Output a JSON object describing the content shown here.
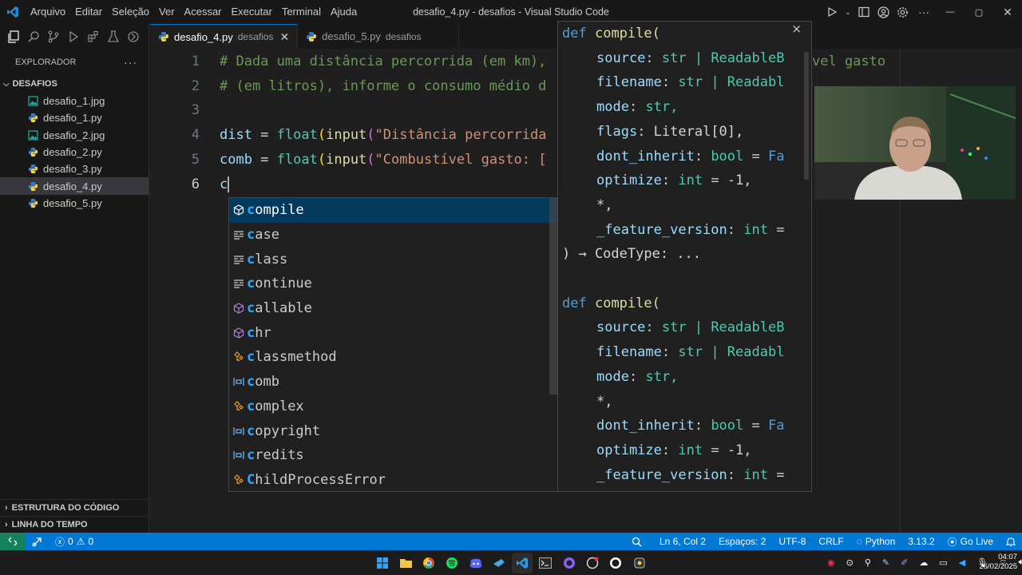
{
  "titlebar": {
    "menu": [
      "Arquivo",
      "Editar",
      "Seleção",
      "Ver",
      "Acessar",
      "Executar",
      "Terminal",
      "Ajuda"
    ],
    "title": "desafio_4.py - desafios - Visual Studio Code"
  },
  "sidebar": {
    "explorer_title": "EXPLORADOR",
    "more": "···",
    "folder": "DESAFIOS",
    "files": [
      {
        "name": "desafio_1.jpg",
        "kind": "image"
      },
      {
        "name": "desafio_1.py",
        "kind": "python"
      },
      {
        "name": "desafio_2.jpg",
        "kind": "image"
      },
      {
        "name": "desafio_2.py",
        "kind": "python"
      },
      {
        "name": "desafio_3.py",
        "kind": "python"
      },
      {
        "name": "desafio_4.py",
        "kind": "python",
        "active": true
      },
      {
        "name": "desafio_5.py",
        "kind": "python"
      }
    ],
    "outline": "ESTRUTURA DO CÓDIGO",
    "timeline": "LINHA DO TEMPO"
  },
  "tabs": [
    {
      "file": "desafio_4.py",
      "desc": "desafios",
      "active": true
    },
    {
      "file": "desafio_5.py",
      "desc": "desafios",
      "active": false
    }
  ],
  "editor": {
    "line_numbers": [
      "1",
      "2",
      "3",
      "4",
      "5",
      "6"
    ],
    "current_line": "6",
    "lines": {
      "l1": "# Dada uma distância percorrida (em km),",
      "l1_tail": "vel gasto",
      "l2": "# (em litros), informe o consumo médio d",
      "l4_var": "dist",
      "l4_str": "\"Distância percorrida",
      "l5_var": "comb",
      "l5_str": "\"Combustível gasto: [",
      "l6": "c",
      "eq": " = ",
      "float": "float",
      "input": "input"
    }
  },
  "suggest": {
    "items": [
      {
        "label_match": "c",
        "label_rest": "ompile",
        "kind": "module"
      },
      {
        "label_match": "c",
        "label_rest": "ase",
        "kind": "keyword"
      },
      {
        "label_match": "c",
        "label_rest": "lass",
        "kind": "keyword"
      },
      {
        "label_match": "c",
        "label_rest": "ontinue",
        "kind": "keyword"
      },
      {
        "label_match": "c",
        "label_rest": "allable",
        "kind": "module"
      },
      {
        "label_match": "c",
        "label_rest": "hr",
        "kind": "module"
      },
      {
        "label_match": "c",
        "label_rest": "lassmethod",
        "kind": "class"
      },
      {
        "label_match": "c",
        "label_rest": "omb",
        "kind": "variable"
      },
      {
        "label_match": "c",
        "label_rest": "omplex",
        "kind": "class"
      },
      {
        "label_match": "c",
        "label_rest": "opyright",
        "kind": "variable"
      },
      {
        "label_match": "c",
        "label_rest": "redits",
        "kind": "variable"
      },
      {
        "label_match": "C",
        "label_rest": "hildProcessError",
        "kind": "class"
      }
    ],
    "selected_index": 0
  },
  "details": {
    "close": "×",
    "sig1": {
      "def": "def",
      "name": "compile(",
      "source": "source",
      "source_type": "str | ReadableB",
      "filename": "filename",
      "filename_type": "str | Readabl",
      "mode": "mode",
      "mode_type": "str,",
      "flags": "flags",
      "flags_type": "Literal[0],",
      "dont_inherit": "dont_inherit",
      "dont_inherit_type": "bool",
      "dont_inherit_def": "Fa",
      "optimize": "optimize",
      "optimize_type": "int",
      "optimize_def": "-1,",
      "star": "*,",
      "fv": "_feature_version",
      "fv_type": "int",
      "ret": ") → CodeType: ..."
    },
    "sig2": {
      "def": "def",
      "name": "compile(",
      "source": "source",
      "source_type": "str | ReadableB",
      "filename": "filename",
      "filename_type": "str | Readabl",
      "mode": "mode",
      "mode_type": "str,",
      "star": "*,",
      "dont_inherit": "dont_inherit",
      "dont_inherit_type": "bool",
      "dont_inherit_def": "Fa",
      "optimize": "optimize",
      "optimize_type": "int",
      "optimize_def": "-1,",
      "fv": "_feature_version",
      "fv_type": "int"
    }
  },
  "statusbar": {
    "errors": "0",
    "warnings": "0",
    "position": "Ln 6, Col 2",
    "spaces": "Espaços: 2",
    "encoding": "UTF-8",
    "eol": "CRLF",
    "language": "Python",
    "version": "3.13.2",
    "golive": "Go Live"
  },
  "taskbar": {
    "time": "04:07",
    "date": "26/02/2025"
  },
  "colors": {
    "accent": "#0078d4",
    "selection": "#04395e",
    "statusbar": "#0078d4"
  }
}
